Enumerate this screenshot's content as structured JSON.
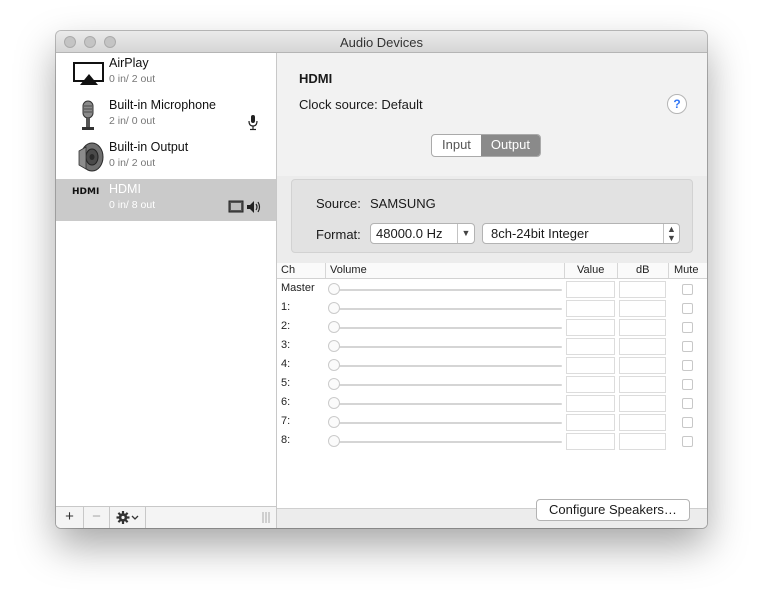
{
  "window": {
    "title": "Audio Devices"
  },
  "devices": [
    {
      "name": "AirPlay",
      "io": "0 in/ 2 out",
      "icon": "airplay-icon",
      "selected": false
    },
    {
      "name": "Built-in Microphone",
      "io": "2 in/ 0 out",
      "icon": "microphone-icon",
      "badge": "microphone-badge-icon",
      "selected": false
    },
    {
      "name": "Built-in Output",
      "io": "0 in/ 2 out",
      "icon": "speaker-icon",
      "selected": false
    },
    {
      "name": "HDMI",
      "io": "0 in/ 8 out",
      "icon": "hdmi-icon",
      "icon_text": "HDMI",
      "selected": true
    }
  ],
  "sidebar_buttons": {
    "add": "+",
    "remove": "−"
  },
  "detail": {
    "title": "HDMI",
    "clock_label": "Clock source:",
    "clock_value": "Default",
    "help": "?",
    "tabs": [
      "Input",
      "Output"
    ],
    "active_tab": "Output",
    "source_label": "Source:",
    "source_value": "SAMSUNG",
    "format_label": "Format:",
    "sample_rate": "48000.0 Hz",
    "bit_format": "8ch-24bit Integer"
  },
  "table": {
    "headers": {
      "ch": "Ch",
      "volume": "Volume",
      "value": "Value",
      "db": "dB",
      "mute": "Mute"
    },
    "channels": [
      "Master",
      "1:",
      "2:",
      "3:",
      "4:",
      "5:",
      "6:",
      "7:",
      "8:"
    ]
  },
  "configure_button": "Configure Speakers…",
  "colors": {
    "selection": "#cacaca",
    "help_accent": "#3478f6",
    "active_tab": "#8a8a8a"
  }
}
